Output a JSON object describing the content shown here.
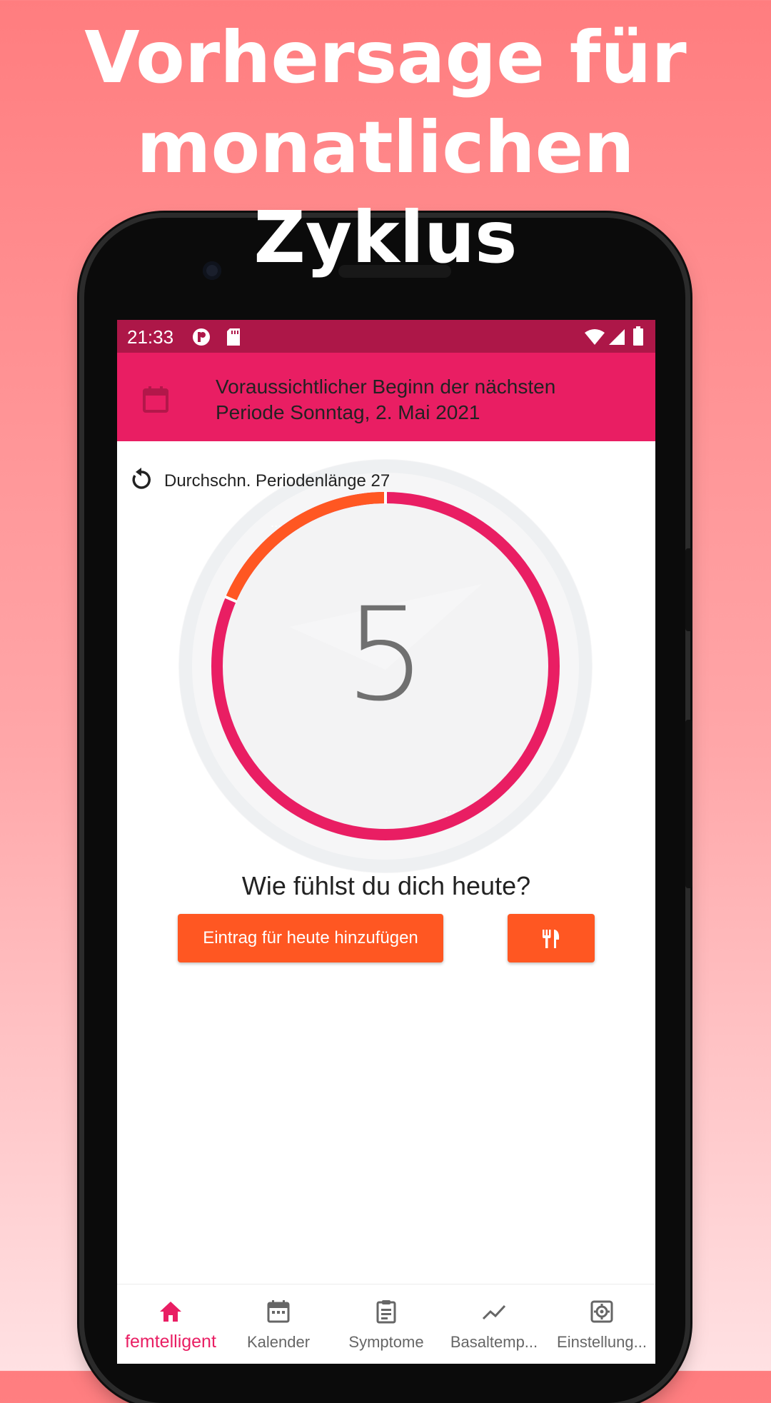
{
  "headline": {
    "line1": "Vorhersage für",
    "line2": "monatlichen",
    "line3": "Zyklus"
  },
  "status_bar": {
    "time": "21:33"
  },
  "app_bar": {
    "message_line1": "Voraussichtlicher Beginn der nächsten",
    "message_line2": "Periode Sonntag, 2. Mai 2021",
    "icon": "calendar-icon"
  },
  "cycle": {
    "avg_label": "Durchschn. Periodenlänge 27",
    "current_day": "5",
    "progress_fraction": 0.185,
    "segment_text": "..."
  },
  "question": "Wie fühlst du dich heute?",
  "buttons": {
    "add_entry": "Eintrag für heute hinzufügen",
    "food_icon": "fork-knife-icon"
  },
  "nav": [
    {
      "label": "femtelligent",
      "icon": "home-icon",
      "active": true
    },
    {
      "label": "Kalender",
      "icon": "calendar-icon",
      "active": false
    },
    {
      "label": "Symptome",
      "icon": "clipboard-icon",
      "active": false
    },
    {
      "label": "Basaltemp...",
      "icon": "trend-icon",
      "active": false
    },
    {
      "label": "Einstellung...",
      "icon": "settings-icon",
      "active": false
    }
  ],
  "colors": {
    "primary": "#e91e63",
    "primary_dark": "#ad1748",
    "accent": "#ff5722",
    "background_top": "#ff7d7f",
    "background_bottom": "#ffe1e3"
  }
}
